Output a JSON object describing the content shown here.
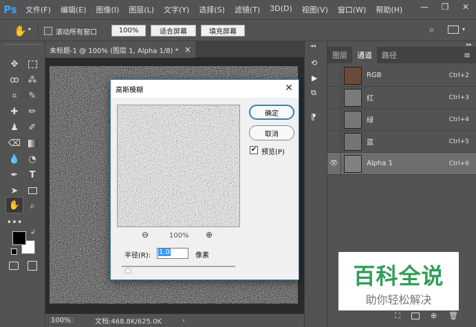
{
  "app": {
    "logo": "Ps"
  },
  "menu": [
    "文件(F)",
    "编辑(E)",
    "图像(I)",
    "图层(L)",
    "文字(Y)",
    "选择(S)",
    "滤镜(T)",
    "3D(D)",
    "视图(V)",
    "窗口(W)",
    "帮助(H)"
  ],
  "window_controls": {
    "minimize": "—",
    "restore": "❐",
    "close": "✕"
  },
  "options": {
    "scroll_all_label": "滚动所有窗口",
    "zoom_value": "100%",
    "fit_screen": "适合屏幕",
    "fill_screen": "填充屏幕"
  },
  "document": {
    "tab_title": "未标题-1 @ 100% (图层 1, Alpha 1/8) *",
    "tab_close": "×",
    "zoom": "100%",
    "doc_info": "文档:468.8K/625.0K"
  },
  "channels_panel": {
    "tabs": [
      "图层",
      "通道",
      "路径"
    ],
    "active_tab": 1,
    "rows": [
      {
        "name": "RGB",
        "shortcut": "Ctrl+2",
        "visible": false,
        "selected": false,
        "thumb": "#6a4a3a"
      },
      {
        "name": "红",
        "shortcut": "Ctrl+3",
        "visible": false,
        "selected": false,
        "thumb": "#7a7a7a"
      },
      {
        "name": "绿",
        "shortcut": "Ctrl+4",
        "visible": false,
        "selected": false,
        "thumb": "#777777"
      },
      {
        "name": "蓝",
        "shortcut": "Ctrl+5",
        "visible": false,
        "selected": false,
        "thumb": "#747474"
      },
      {
        "name": "Alpha 1",
        "shortcut": "Ctrl+6",
        "visible": true,
        "selected": true,
        "thumb": "#808080"
      }
    ]
  },
  "dialog": {
    "title": "高斯模糊",
    "ok": "确定",
    "cancel": "取消",
    "preview_label": "预览(P)",
    "preview_checked": true,
    "zoom": "100%",
    "radius_label": "半径(R):",
    "radius_value": "1.0",
    "unit": "像素",
    "radius_slider": 0.01
  },
  "watermark": {
    "title": "百科全说",
    "subtitle": "助你轻松解决"
  },
  "colors": {
    "ui_bg": "#535353",
    "dark_bg": "#424242",
    "accent": "#31a8ff",
    "selected_row": "#6e6e6e",
    "watermark_green": "#2f9e57"
  }
}
